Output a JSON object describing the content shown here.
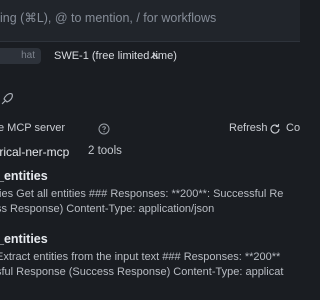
{
  "input": {
    "placeholder": "ing (⌘L), @ to mention, / for workflows"
  },
  "mode": {
    "chip_label": "hat",
    "model_label": "SWE-1 (free limited time)"
  },
  "mcp": {
    "title": "e MCP server",
    "refresh_label": "Refresh",
    "collapse_label": "Co"
  },
  "server": {
    "name": "trical-ner-mcp",
    "tool_count": "2 tools"
  },
  "tools": [
    {
      "name": "_entities",
      "desc1": "ties Get all entities ### Responses: **200**: Successful Re",
      "desc2": "ss Response) Content-Type: application/json"
    },
    {
      "name": "_entities",
      "desc1": "Extract entities from the input text ### Responses: **200**",
      "desc2": "sful Response (Success Response) Content-Type: applicat"
    }
  ]
}
